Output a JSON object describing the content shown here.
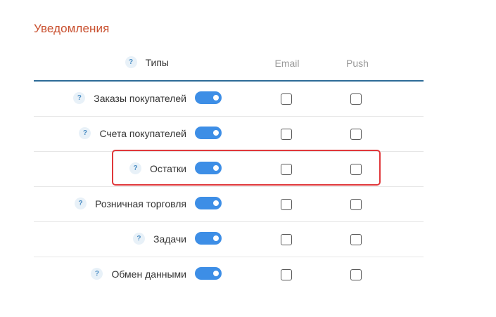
{
  "section": {
    "title": "Уведомления"
  },
  "header": {
    "types_label": "Типы",
    "email_label": "Email",
    "push_label": "Push"
  },
  "rows": [
    {
      "label": "Заказы покупателей",
      "enabled": true,
      "email": false,
      "push": false
    },
    {
      "label": "Счета покупателей",
      "enabled": true,
      "email": false,
      "push": false
    },
    {
      "label": "Остатки",
      "enabled": true,
      "email": false,
      "push": false
    },
    {
      "label": "Розничная торговля",
      "enabled": true,
      "email": false,
      "push": false
    },
    {
      "label": "Задачи",
      "enabled": true,
      "email": false,
      "push": false
    },
    {
      "label": "Обмен данными",
      "enabled": true,
      "email": false,
      "push": false
    }
  ],
  "help_glyph": "?",
  "colors": {
    "title": "#c9502f",
    "accent": "#3d8ee6",
    "header_border": "#2d6b97",
    "highlight": "#e0383b"
  },
  "icons": {
    "help": "question-circle-icon"
  }
}
